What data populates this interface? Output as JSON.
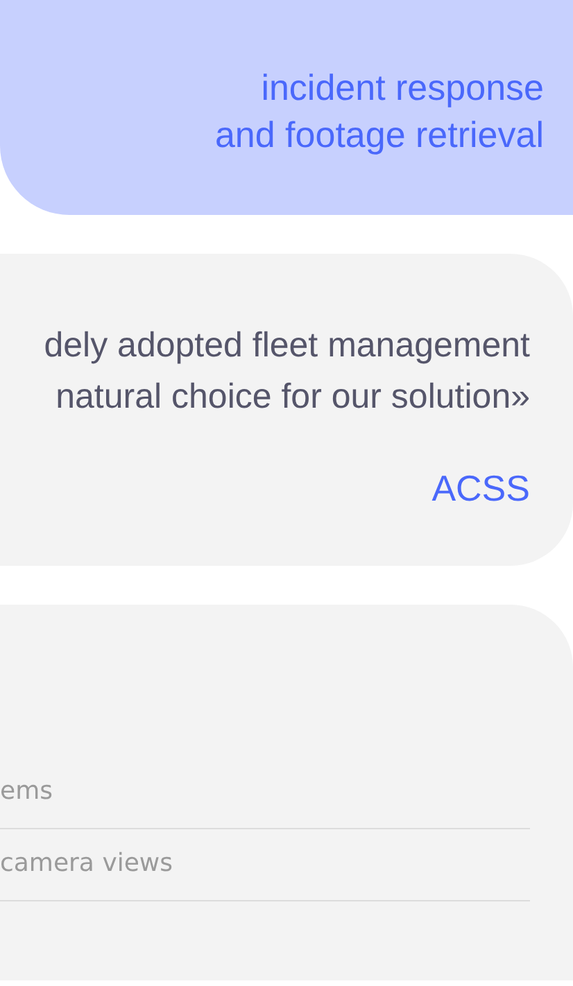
{
  "hero": {
    "subheading": "incident response\nand footage retrieval"
  },
  "testimonial": {
    "quote": "dely adopted fleet management\nnatural choice for our solution»",
    "author": "ACSS"
  },
  "feature_list": {
    "items": [
      "ems",
      "camera views"
    ]
  }
}
